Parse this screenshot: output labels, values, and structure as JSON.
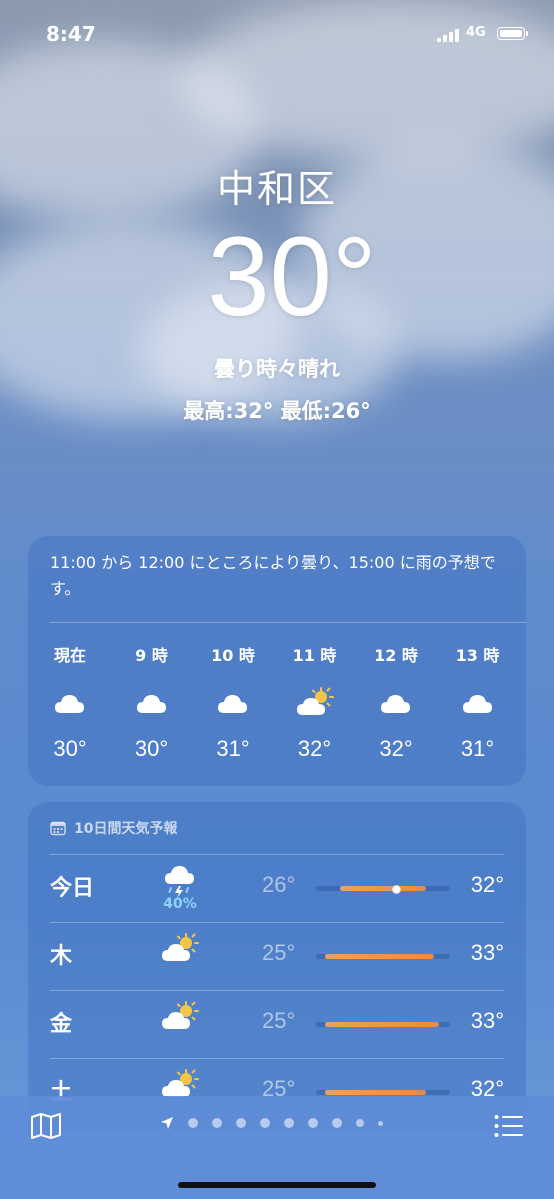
{
  "status": {
    "time": "8:47",
    "network": "4G"
  },
  "location": {
    "city": "中和区",
    "temperature": "30°",
    "condition": "曇り時々晴れ",
    "high_low": "最高:32°  最低:26°"
  },
  "hourly": {
    "summary": "11:00 から 12:00 にところにより曇り、15:00 に雨の予想です。",
    "hours": [
      {
        "label": "現在",
        "icon": "cloud-icon",
        "temp": "30°"
      },
      {
        "label": "9 時",
        "icon": "cloud-icon",
        "temp": "30°"
      },
      {
        "label": "10 時",
        "icon": "cloud-icon",
        "temp": "31°"
      },
      {
        "label": "11 時",
        "icon": "partly-sunny-icon",
        "temp": "32°"
      },
      {
        "label": "12 時",
        "icon": "cloud-icon",
        "temp": "32°"
      },
      {
        "label": "13 時",
        "icon": "cloud-icon",
        "temp": "31°"
      }
    ]
  },
  "daily": {
    "header": "10日間天気予報",
    "days": [
      {
        "name": "今日",
        "icon": "thunderstorm-icon",
        "pop": "40%",
        "low": "26°",
        "high": "32°",
        "range_start": 0.18,
        "range_end": 0.82,
        "current": 0.59
      },
      {
        "name": "木",
        "icon": "partly-sunny-icon",
        "pop": "",
        "low": "25°",
        "high": "33°",
        "range_start": 0.07,
        "range_end": 0.88
      },
      {
        "name": "金",
        "icon": "partly-sunny-icon",
        "pop": "",
        "low": "25°",
        "high": "33°",
        "range_start": 0.07,
        "range_end": 0.92
      },
      {
        "name": "土",
        "icon": "partly-sunny-icon",
        "pop": "",
        "low": "25°",
        "high": "32°",
        "range_start": 0.07,
        "range_end": 0.82
      }
    ]
  },
  "bottom": {
    "page_dots": 9
  },
  "colors": {
    "range_gradient_start": "#e9a35c",
    "range_gradient_end": "#e98a45",
    "precip": "#8fd4ff"
  }
}
